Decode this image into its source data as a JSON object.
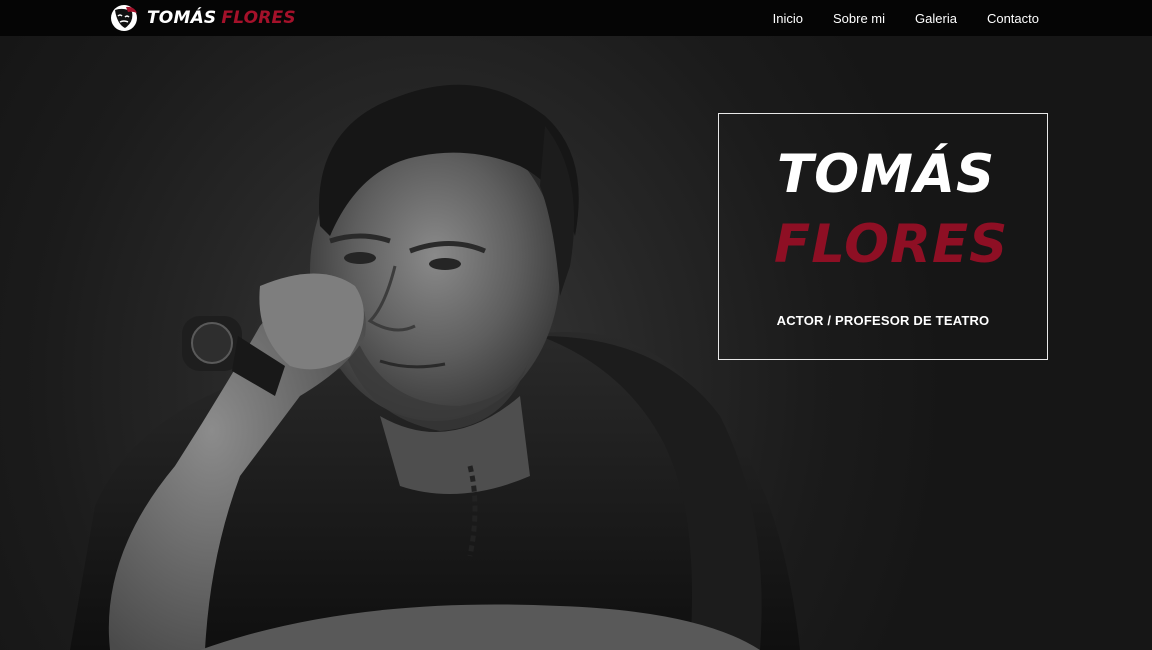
{
  "nav": {
    "brand": {
      "first": "TOMÁS",
      "last": "FLORES",
      "logo_icon": "theater-mask-icon"
    },
    "links": [
      {
        "label": "Inicio"
      },
      {
        "label": "Sobre mi"
      },
      {
        "label": "Galeria"
      },
      {
        "label": "Contacto"
      }
    ]
  },
  "hero": {
    "first": "TOMÁS",
    "last": "FLORES",
    "subtitle": "ACTOR / PROFESOR DE TEATRO",
    "image": "portrait-photo"
  },
  "colors": {
    "accent": "#8e0f24",
    "nav_bg": "#050505",
    "text": "#ffffff"
  }
}
